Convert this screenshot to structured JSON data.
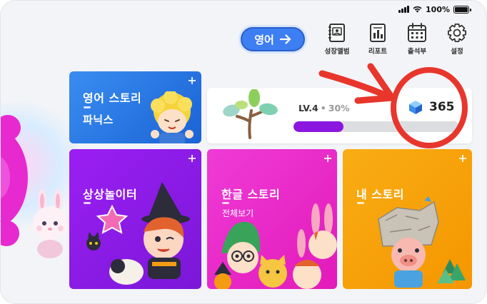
{
  "status_bar": {
    "battery": "100%"
  },
  "nav": {
    "english_button": "영어",
    "items": [
      {
        "label": "성장앨범",
        "icon": "album-icon"
      },
      {
        "label": "리포트",
        "icon": "report-icon"
      },
      {
        "label": "출석부",
        "icon": "calendar-icon"
      },
      {
        "label": "설정",
        "icon": "gear-icon"
      }
    ]
  },
  "cards": {
    "english_story": {
      "title": "영어 스토리",
      "subtitle": "파닉스",
      "color": "#2f7ce9"
    },
    "progress": {
      "level": "LV.4",
      "percent_text": "30%",
      "progress": 0.3,
      "coins": "365"
    },
    "imagination": {
      "title": "상상놀이터",
      "color": "#8a1ae8"
    },
    "hangul_story": {
      "title": "한글 스토리",
      "subtitle": "전체보기",
      "color": "#e826c8"
    },
    "my_story": {
      "title": "내 스토리",
      "color": "#f7a20a"
    }
  },
  "annotation": {
    "color": "#e8362c"
  }
}
